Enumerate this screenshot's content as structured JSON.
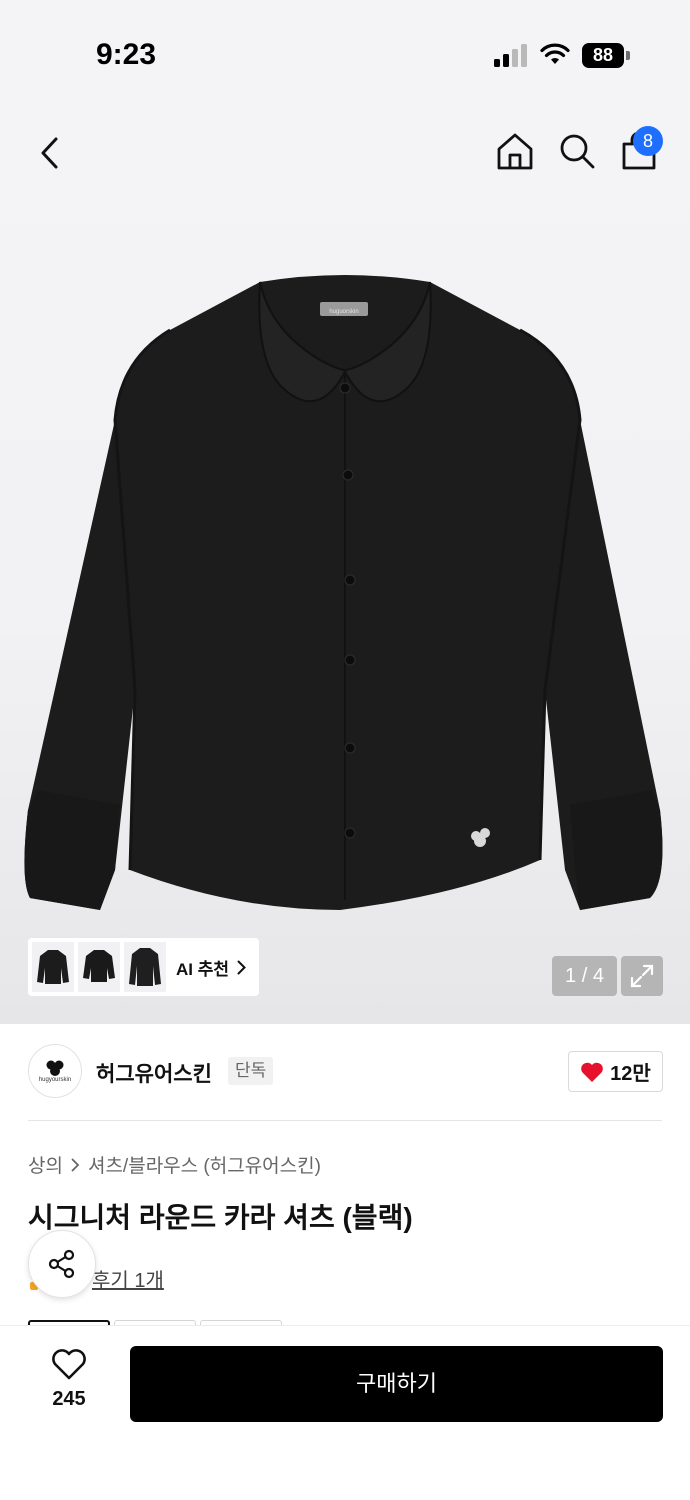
{
  "status_bar": {
    "time": "9:23",
    "battery": "88"
  },
  "nav": {
    "cart_count": "8"
  },
  "gallery": {
    "ai_recommend_label": "AI 추천",
    "page_counter": "1 / 4",
    "thumbnail_count": 3,
    "shirt_logo_text": "huguorskin"
  },
  "brand": {
    "name": "허그유어스킨",
    "tag": "단독",
    "logo_text": "hugyourskin",
    "like_count": "12만"
  },
  "breadcrumb": {
    "category": "상의",
    "subcategory": "셔츠/블라우스 (허그유어스킨)"
  },
  "product": {
    "title": "시그니처 라운드 카라 셔츠 (블랙)"
  },
  "review": {
    "label": "후기 1개"
  },
  "bottom_bar": {
    "wish_count": "245",
    "buy_label": "구매하기"
  },
  "colors": {
    "accent_badge": "#1f6fff",
    "heart": "#e8112d",
    "buy_button": "#000000",
    "shirt": "#1b1b1b"
  }
}
